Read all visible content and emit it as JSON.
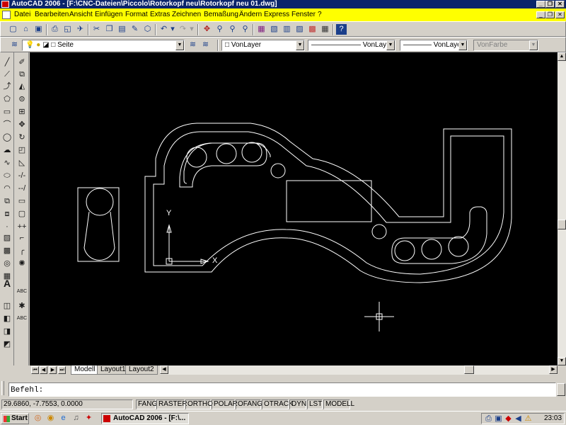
{
  "window": {
    "title": "AutoCAD 2006 - [F:\\CNC-Dateien\\Piccolo\\Rotorkopf neu\\Rotorkopf neu 01.dwg]",
    "title_buttons": [
      "_",
      "❐",
      "✕"
    ],
    "doc_buttons": [
      "_",
      "❐",
      "✕"
    ]
  },
  "menu": [
    "Datei",
    "Bearbeiten",
    "Ansicht",
    "Einfügen",
    "Format",
    "Extras",
    "Zeichnen",
    "Bemaßung",
    "Ändern",
    "Express",
    "Fenster",
    "?"
  ],
  "toolbar": {
    "standard_icons": [
      "new-icon",
      "open-icon",
      "save-icon",
      "print-icon",
      "preview-icon",
      "publish-icon",
      "cut-icon",
      "copy-icon",
      "paste-icon",
      "match-properties-icon",
      "block-editor-icon",
      "undo-icon",
      "redo-icon",
      "pan-icon",
      "zoom-realtime-icon",
      "zoom-window-icon",
      "zoom-previous-icon",
      "properties-icon",
      "design-center-icon",
      "tool-palettes-icon",
      "sheet-set-icon",
      "markup-icon",
      "calculator-icon",
      "help-icon"
    ]
  },
  "layers": {
    "layer_name": "Seite",
    "color": "VonLayer",
    "linetype": "VonLayer",
    "lineweight": "VonLayer",
    "plotstyle": "VonFarbe"
  },
  "draw_tools": [
    "line-icon",
    "construction-line-icon",
    "polyline-icon",
    "polygon-icon",
    "rectangle-icon",
    "arc-icon",
    "circle-icon",
    "revision-cloud-icon",
    "spline-icon",
    "ellipse-icon",
    "ellipse-arc-icon",
    "insert-block-icon",
    "make-block-icon",
    "point-icon",
    "hatch-icon",
    "gradient-icon",
    "region-icon",
    "table-icon",
    "text-icon"
  ],
  "modify_tools": [
    "erase-icon",
    "copy-object-icon",
    "mirror-icon",
    "offset-icon",
    "array-icon",
    "move-icon",
    "rotate-icon",
    "scale-icon",
    "stretch-icon",
    "trim-icon",
    "extend-icon",
    "break-at-point-icon",
    "break-icon",
    "join-icon",
    "chamfer-icon",
    "fillet-icon",
    "explode-icon"
  ],
  "ucs": {
    "x_label": "X",
    "y_label": "Y"
  },
  "tabs": [
    "Modell",
    "Layout1",
    "Layout2"
  ],
  "active_tab": "Modell",
  "command": {
    "prompt": "Befehl:"
  },
  "status": {
    "coords": "29.6860, -7.7553, 0.0000",
    "toggles": [
      "FANG",
      "RASTER",
      "ORTHO",
      "POLAR",
      "OFANG",
      "OTRACK",
      "DYN",
      "LST",
      "MODELL"
    ]
  },
  "taskbar": {
    "start": "Start",
    "item": "AutoCAD 2006 - [F:\\...",
    "clock": "23:03"
  },
  "colors": {
    "titlebar": "#0a246a",
    "menubar": "#ffff00",
    "canvas": "#000000",
    "linework": "#ffffff"
  }
}
